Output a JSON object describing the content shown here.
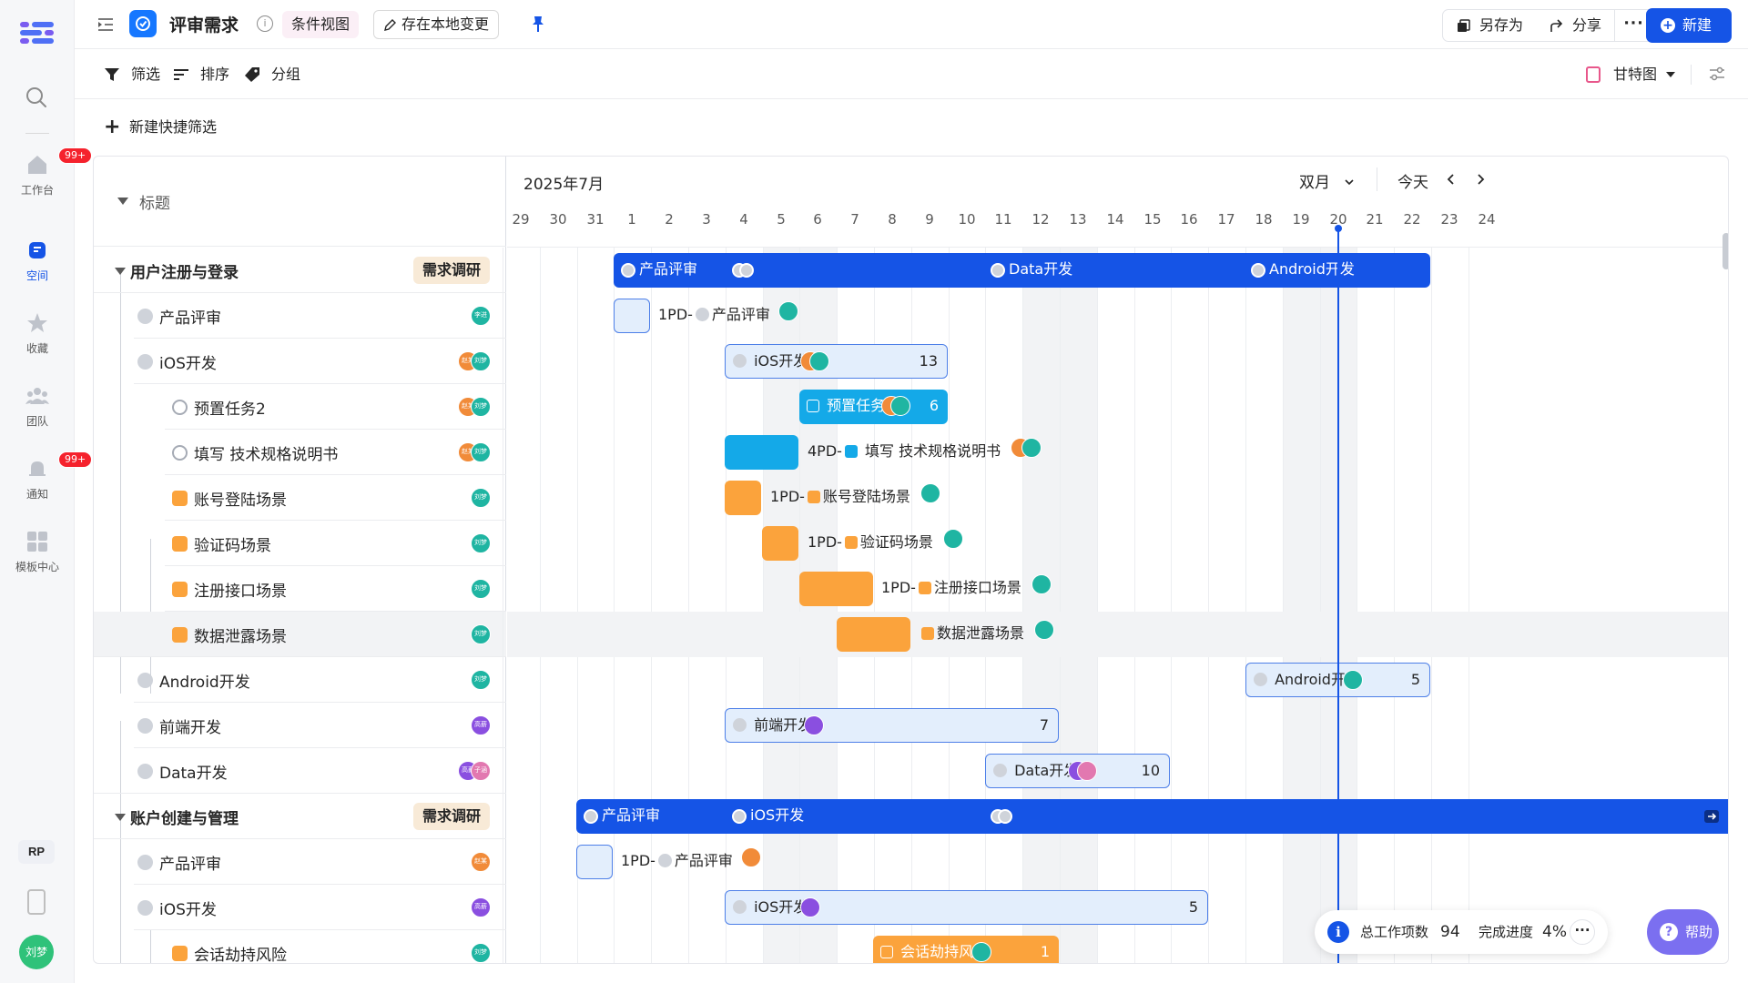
{
  "rail": {
    "items": [
      {
        "label": "工作台",
        "badge": "99+"
      },
      {
        "label": "空间"
      },
      {
        "label": "收藏"
      },
      {
        "label": "团队"
      },
      {
        "label": "通知",
        "badge": "99+"
      },
      {
        "label": "模板中心"
      }
    ],
    "rp": "RP",
    "user": "刘梦"
  },
  "header": {
    "title": "评审需求",
    "info_icon": "i",
    "view_tag": "条件视图",
    "save_local": "存在本地变更",
    "save_as": "另存为",
    "share": "分享",
    "more": "···",
    "new": "新建"
  },
  "toolbar": {
    "filter": "筛选",
    "sort": "排序",
    "group": "分组",
    "view": "甘特图",
    "quick_filter": "新建快捷筛选"
  },
  "table": {
    "title_col": "标题",
    "rows": [
      {
        "title": "用户注册与登录",
        "tag": "需求调研",
        "kind": "group"
      },
      {
        "title": "产品评审",
        "avatars": [
          "李进"
        ]
      },
      {
        "title": "iOS开发",
        "avatars": [
          "赵某",
          "刘梦"
        ]
      },
      {
        "title": "预置任务2",
        "avatars": [
          "赵某",
          "刘梦"
        ]
      },
      {
        "title": "填写 技术规格说明书",
        "avatars": [
          "赵某",
          "刘梦"
        ]
      },
      {
        "title": "账号登陆场景",
        "avatars": [
          "刘梦"
        ]
      },
      {
        "title": "验证码场景",
        "avatars": [
          "刘梦"
        ]
      },
      {
        "title": "注册接口场景",
        "avatars": [
          "刘梦"
        ]
      },
      {
        "title": "数据泄露场景",
        "avatars": [
          "刘梦"
        ]
      },
      {
        "title": "Android开发",
        "avatars": [
          "刘梦"
        ]
      },
      {
        "title": "前端开发",
        "avatars": [
          "高薪"
        ]
      },
      {
        "title": "Data开发",
        "avatars": [
          "高薪",
          "子涵"
        ]
      },
      {
        "title": "账户创建与管理",
        "tag": "需求调研",
        "kind": "group"
      },
      {
        "title": "产品评审",
        "avatars": [
          "赵某"
        ]
      },
      {
        "title": "iOS开发",
        "avatars": [
          "高薪"
        ]
      },
      {
        "title": "会话劫持风险",
        "avatars": [
          "刘梦"
        ]
      }
    ]
  },
  "gantt": {
    "month": "2025年7月",
    "range": "双月",
    "today": "今天",
    "days": [
      "29",
      "30",
      "31",
      "1",
      "2",
      "3",
      "4",
      "5",
      "6",
      "7",
      "8",
      "9",
      "10",
      "11",
      "12",
      "13",
      "14",
      "15",
      "16",
      "17",
      "18",
      "19",
      "20",
      "21",
      "22",
      "23",
      "24"
    ],
    "labels": {
      "g1_a": "产品评审",
      "g1_b": "Data开发",
      "g1_c": "Android开发",
      "r1": "1PD-",
      "r1b": "产品评审",
      "r2": "iOS开发",
      "r2n": "13",
      "r3": "预置任务2",
      "r3n": "6",
      "r4a": "4PD-",
      "r4b": "填写 技术规格说明书",
      "r5a": "1PD-",
      "r5b": "账号登陆场景",
      "r6a": "1PD-",
      "r6b": "验证码场景",
      "r7a": "1PD-",
      "r7b": "注册接口场景",
      "r8b": "数据泄露场景",
      "r9": "Android开发",
      "r9n": "5",
      "r10": "前端开发",
      "r10n": "7",
      "r11": "Data开发",
      "r11n": "10",
      "g2_a": "产品评审",
      "g2_b": "iOS开发",
      "r13a": "1PD-",
      "r13b": "产品评审",
      "r14": "iOS开发",
      "r14n": "5",
      "r15": "会话劫持风险",
      "r15n": "1"
    }
  },
  "stats": {
    "total_label": "总工作项数",
    "total": "94",
    "progress_label": "完成进度",
    "progress": "4%"
  },
  "help": "帮助",
  "colors": {
    "primary": "#1554e6",
    "orange": "#fba33c",
    "cyan": "#14a9e8",
    "light": "#e3eefc"
  }
}
